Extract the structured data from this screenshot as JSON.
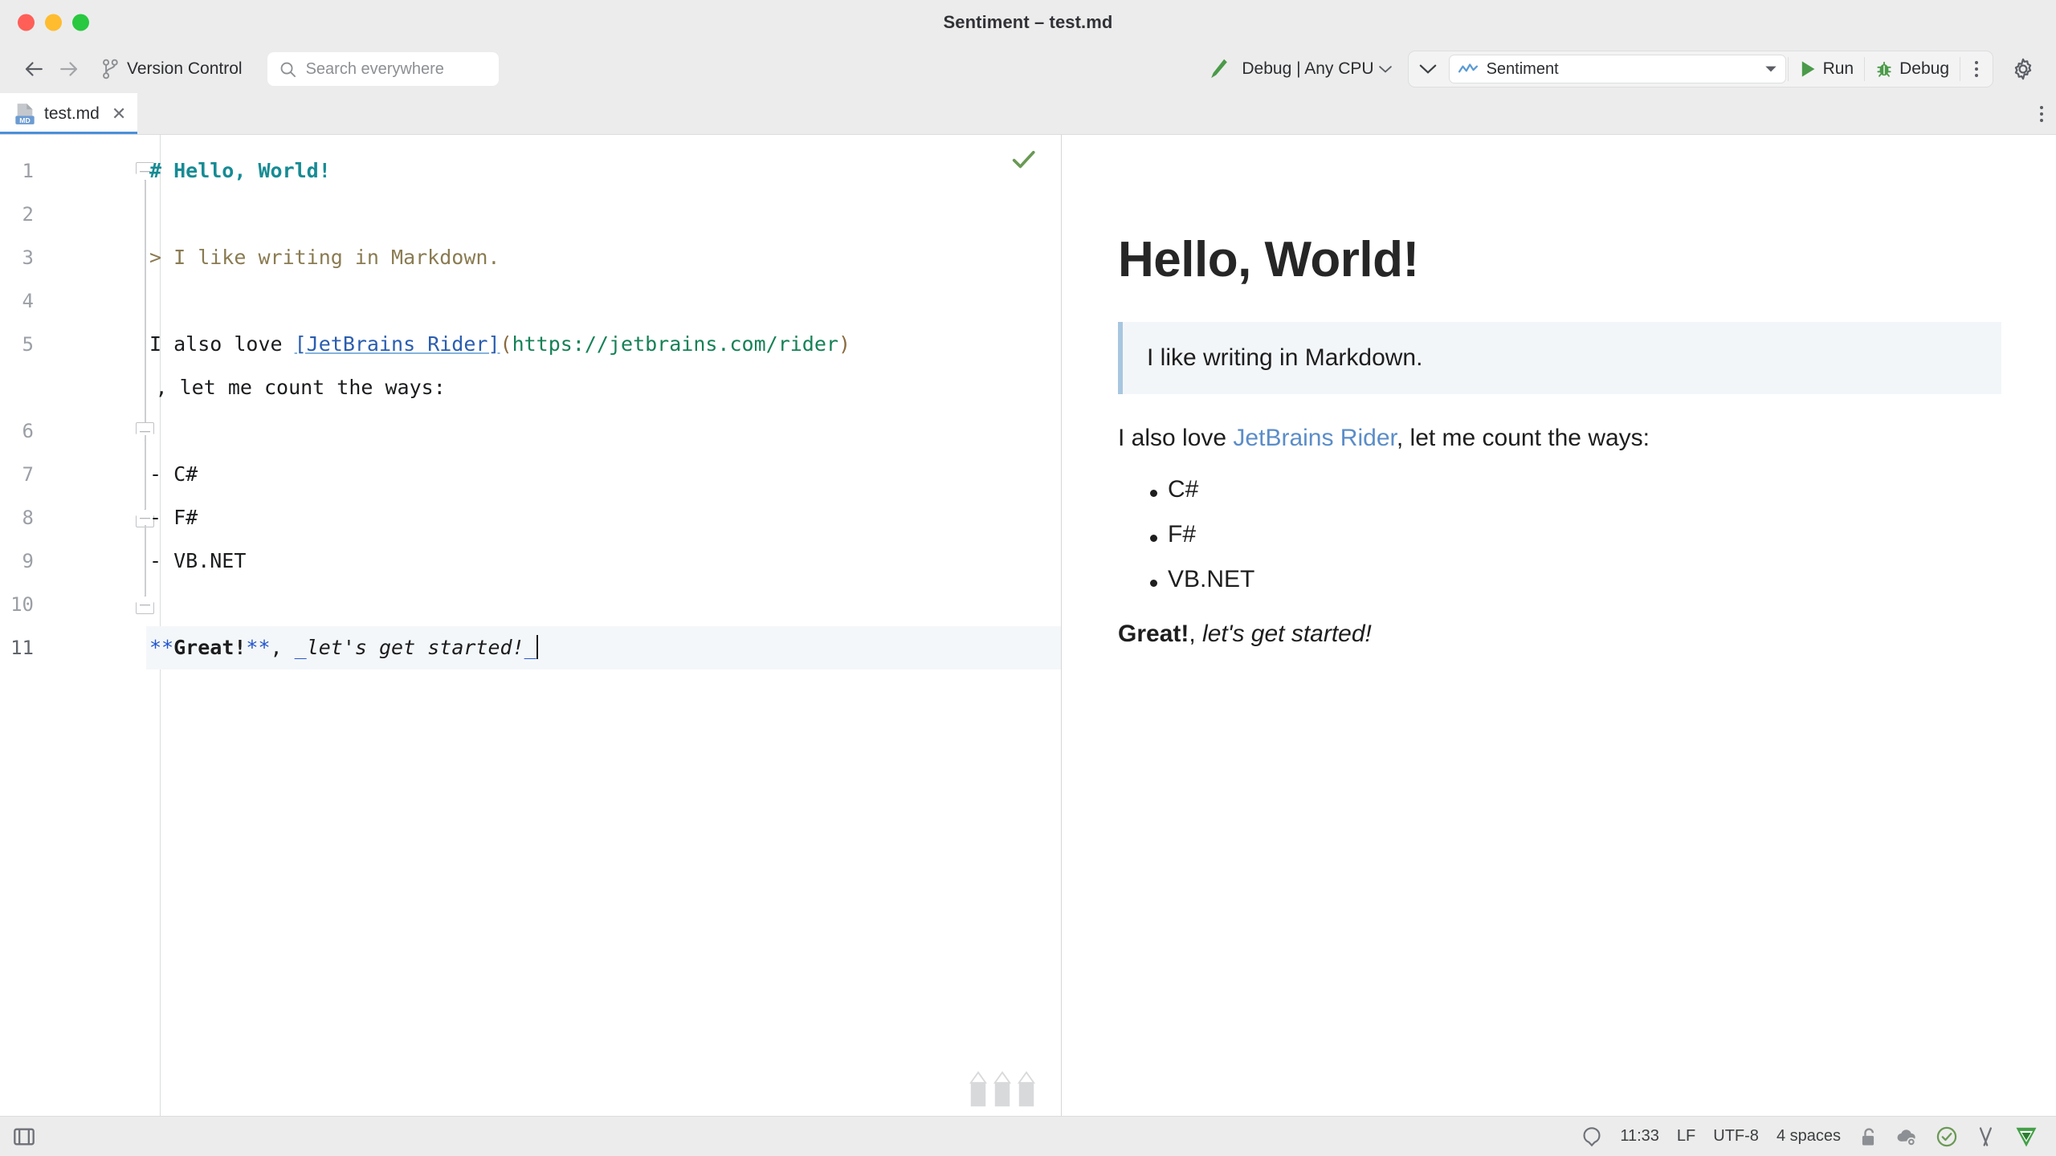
{
  "window": {
    "title": "Sentiment – test.md",
    "traffic_lights": [
      "close",
      "minimize",
      "zoom"
    ]
  },
  "toolbar": {
    "back_icon": "arrow-left-icon",
    "forward_icon": "arrow-right-icon",
    "vcs_label": "Version Control",
    "vcs_icon": "branch-icon",
    "search_placeholder": "Search everywhere",
    "search_icon": "search-icon",
    "build_icon": "build-hammer-icon",
    "configuration": "Debug | Any CPU",
    "run_config_name": "Sentiment",
    "run_config_icon": "sentiment-project-icon",
    "run_label": "Run",
    "debug_label": "Debug",
    "more_icon": "more-vertical-icon",
    "settings_icon": "gear-icon",
    "accent_green": "#4A9A49",
    "chevron_icon": "chevron-down-icon"
  },
  "tabs": {
    "items": [
      {
        "label": "test.md",
        "icon": "markdown-file-icon",
        "active": true,
        "close_icon": "close-icon"
      }
    ],
    "options_icon": "more-vertical-icon"
  },
  "editor": {
    "inspection_icon": "inspection-ok-check-icon",
    "watermark_icon": "pencils-watermark-icon",
    "line_numbers": [
      "1",
      "2",
      "3",
      "4",
      "5",
      "6",
      "7",
      "8",
      "9",
      "10",
      "11"
    ],
    "current_line": 11,
    "lines": [
      {
        "num": "1",
        "text": "# Hello, World!"
      },
      {
        "num": "2",
        "text": ""
      },
      {
        "num": "3",
        "text": "> I like writing in Markdown."
      },
      {
        "num": "4",
        "text": ""
      },
      {
        "num": "5",
        "text": "I also love [JetBrains Rider](https://jetbrains.com/rider), let me count the ways:"
      },
      {
        "num": "6",
        "text": ""
      },
      {
        "num": "7",
        "text": "- C#"
      },
      {
        "num": "8",
        "text": "- F#"
      },
      {
        "num": "9",
        "text": "- VB.NET"
      },
      {
        "num": "10",
        "text": ""
      },
      {
        "num": "11",
        "text": "**Great!**, _let's get started!_"
      }
    ],
    "tokens": {
      "heading": "# Hello, World!",
      "quote": "> I like writing in Markdown.",
      "para_pre": "I also love ",
      "link_text": "[JetBrains Rider]",
      "paren_open": "(",
      "url": "https://jetbrains.com/rider",
      "paren_close": ")",
      "para_wrap": ", let me count the ways:",
      "bullet_1": "- C#",
      "bullet_2": "- F#",
      "bullet_3": "- VB.NET",
      "bold_marker": "**",
      "bold_text": "Great!",
      "comma": ", ",
      "em_marker": "_",
      "em_text": "let's get started!"
    },
    "colors": {
      "heading": "#168B94",
      "blockquote": "#8A7B52",
      "link": "#2A5DB0",
      "url": "#158156",
      "paren": "#8A6A3E",
      "marker": "#2255CC",
      "current_line_bg": "#F4F7F9"
    }
  },
  "preview": {
    "h1": "Hello, World!",
    "blockquote": "I like writing in Markdown.",
    "paragraph_pre": "I also love ",
    "paragraph_link": "JetBrains Rider",
    "paragraph_post": ", let me count the ways:",
    "list": [
      "C#",
      "F#",
      "VB.NET"
    ],
    "final_bold": "Great!",
    "final_comma": ", ",
    "final_italic": "let's get started!",
    "link_color": "#5B8DC8",
    "quote_bg": "#F3F6F9",
    "quote_border": "#A8C6E0"
  },
  "statusbar": {
    "layout_icon": "toggle-tool-window-icon",
    "search_icon": "search-status-icon",
    "time": "11:33",
    "line_separator": "LF",
    "encoding": "UTF-8",
    "indent": "4 spaces",
    "lock_icon": "unlocked-icon",
    "cloud_icon": "cloud-settings-icon",
    "inspection_icon": "inspection-ok-icon",
    "nuget_icon": "nuget-icon",
    "rider_icon": "rider-logo-icon"
  }
}
